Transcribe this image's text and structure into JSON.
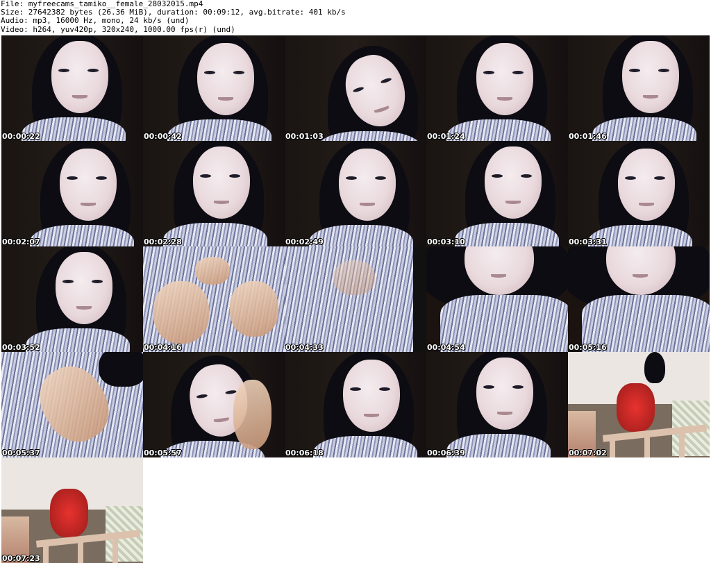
{
  "header": {
    "file_line": "File: myfreecams_tamiko__female_28032015.mp4",
    "size_line": "Size: 27642382 bytes (26.36 MiB), duration: 00:09:12, avg.bitrate: 401 kb/s",
    "audio_line": "Audio: mp3, 16000 Hz, mono, 24 kb/s (und)",
    "video_line": "Video: h264, yuv420p, 320x240, 1000.00 fps(r) (und)"
  },
  "thumbnails": [
    {
      "timestamp": "00:00:22",
      "scene": "face"
    },
    {
      "timestamp": "00:00:42",
      "scene": "face"
    },
    {
      "timestamp": "00:01:03",
      "scene": "face-tilt"
    },
    {
      "timestamp": "00:01:24",
      "scene": "face"
    },
    {
      "timestamp": "00:01:46",
      "scene": "face"
    },
    {
      "timestamp": "00:02:07",
      "scene": "face"
    },
    {
      "timestamp": "00:02:28",
      "scene": "face"
    },
    {
      "timestamp": "00:02:49",
      "scene": "face"
    },
    {
      "timestamp": "00:03:10",
      "scene": "face"
    },
    {
      "timestamp": "00:03:31",
      "scene": "face"
    },
    {
      "timestamp": "00:03:52",
      "scene": "face"
    },
    {
      "timestamp": "00:04:16",
      "scene": "hands"
    },
    {
      "timestamp": "00:04:33",
      "scene": "shirt"
    },
    {
      "timestamp": "00:04:54",
      "scene": "lowface"
    },
    {
      "timestamp": "00:05:16",
      "scene": "lowface"
    },
    {
      "timestamp": "00:05:37",
      "scene": "arm"
    },
    {
      "timestamp": "00:05:57",
      "scene": "face-hand"
    },
    {
      "timestamp": "00:06:18",
      "scene": "face"
    },
    {
      "timestamp": "00:06:39",
      "scene": "face"
    },
    {
      "timestamp": "00:07:02",
      "scene": "room"
    },
    {
      "timestamp": "00:07:23",
      "scene": "room"
    }
  ]
}
